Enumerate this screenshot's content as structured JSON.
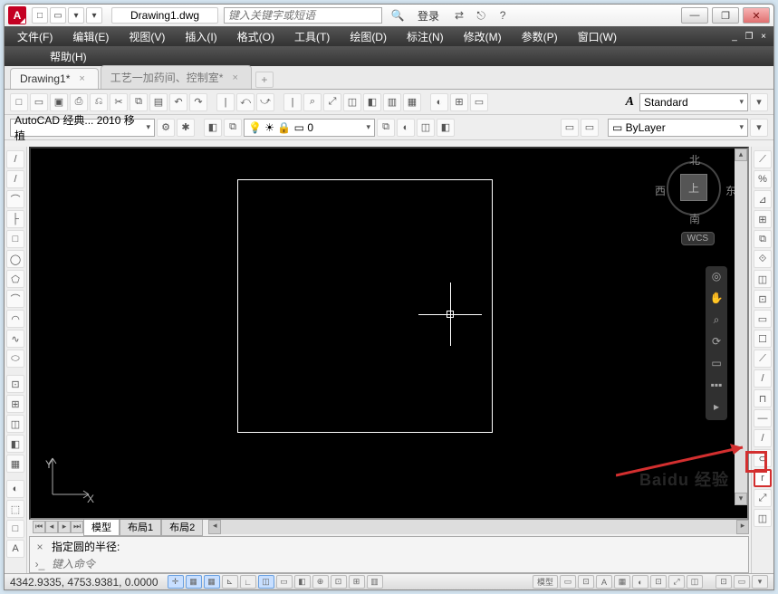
{
  "app": {
    "logo_letter": "A",
    "doc_title": "Drawing1.dwg",
    "search_placeholder": "键入关键字或短语"
  },
  "title_buttons": {
    "login": "登录",
    "xchg": "⇄",
    "help": "?"
  },
  "win": {
    "min": "—",
    "max": "❐",
    "close": "✕"
  },
  "menu": [
    "文件(F)",
    "编辑(E)",
    "视图(V)",
    "插入(I)",
    "格式(O)",
    "工具(T)",
    "绘图(D)",
    "标注(N)",
    "修改(M)",
    "参数(P)",
    "窗口(W)"
  ],
  "menu_help": "帮助(H)",
  "mdi": {
    "min": "_",
    "restore": "❐",
    "close": "×"
  },
  "doctabs": [
    {
      "label": "Drawing1*",
      "active": true
    },
    {
      "label": "工艺一加药间、控制室*",
      "active": false
    }
  ],
  "toolbar1_icons": [
    "□",
    "▭",
    "▣",
    "⎙",
    "⎌",
    "✂",
    "⧉",
    "▤",
    "↶",
    "↷",
    "·",
    "|",
    "⤺",
    "⤻",
    "·",
    "|",
    "⌕",
    "⤢",
    "◫",
    "◧",
    "▥",
    "▦",
    "·",
    "◐",
    "⊞",
    "▭"
  ],
  "toolbar2": {
    "workspace": "AutoCAD 经典... 2010 移植",
    "ws_icons": [
      "⚙",
      "✱"
    ],
    "layer_icons": [
      "◧",
      "⧉"
    ],
    "layer": "💡 ☀ 🔒 ▭ 0",
    "layer_post": [
      "⧉",
      "◐",
      "◫",
      "◧"
    ],
    "bylayer": "▭ ByLayer"
  },
  "toolbar_right": {
    "style_label": "Standard",
    "A": "A"
  },
  "ltool": [
    "/",
    "/",
    "⌒",
    "├",
    "□",
    "◯",
    "⬠",
    "⌒",
    "◠",
    "∿",
    "⬭",
    "·",
    "⊡",
    "⊞",
    "◫",
    "◧",
    "▦",
    "·",
    "◐",
    "⬚",
    "□",
    "A"
  ],
  "rtool": [
    "⟋",
    "%",
    "⊿",
    "⊞",
    "⧉",
    "⟐",
    "◫",
    "⊡",
    "▭",
    "☐",
    "⟋",
    "/",
    "⊓",
    "—",
    "/",
    "⊂",
    "r",
    "⤢",
    "◫"
  ],
  "viewcube": {
    "n": "北",
    "e": "东",
    "s": "南",
    "w": "西",
    "top": "上",
    "wcs": "WCS"
  },
  "ucs": {
    "x": "X",
    "y": "Y"
  },
  "tabs": {
    "model": "模型",
    "layout1": "布局1",
    "layout2": "布局2"
  },
  "cmd": {
    "prompt": "指定圆的半径:",
    "hint": "键入命令"
  },
  "status": {
    "coords": "4342.9335, 4753.9381, 0.0000",
    "toggles": [
      "✛",
      "▦",
      "▦",
      "⊾",
      "∟",
      "◫",
      "▭",
      "◧",
      "⊕",
      "⊡",
      "⊞",
      "▥"
    ],
    "model": "模型",
    "extras": [
      "▭",
      "⊡",
      "А",
      "▦",
      "◐",
      "⊡",
      "⤢",
      "◫"
    ],
    "tray": [
      "⊡",
      "▭",
      "▾"
    ]
  },
  "watermark": "Baidu 经验"
}
